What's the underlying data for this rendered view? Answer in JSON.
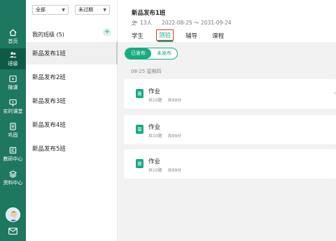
{
  "nav": {
    "items": [
      {
        "label": "首页",
        "icon": "home-icon"
      },
      {
        "label": "班级",
        "icon": "people-icon",
        "active": true
      },
      {
        "label": "微课",
        "icon": "play-icon"
      },
      {
        "label": "实时课堂",
        "icon": "live-icon"
      },
      {
        "label": "巩固",
        "icon": "document-icon"
      },
      {
        "label": "教研中心",
        "icon": "research-icon"
      },
      {
        "label": "资料中心",
        "icon": "layers-icon"
      }
    ]
  },
  "filters": {
    "grade": "全部",
    "period": "未过期"
  },
  "classes": {
    "heading": "我的班级 (5)",
    "add_label": "+",
    "items": [
      "新品发布1班",
      "新品发布2班",
      "新品发布3班",
      "新品发布4班",
      "新品发布5班"
    ]
  },
  "header": {
    "title": "新品发布1班",
    "students": "13人",
    "date_range": "2022-08-25 ～ 2031-09-24",
    "tabs": [
      "学生",
      "测验",
      "辅导",
      "课程"
    ]
  },
  "status_toggle": {
    "published": "已发布",
    "unpublished": "未发布"
  },
  "date_label": "08-25 星期四",
  "assignments": [
    {
      "title": "作业",
      "count": "共10题",
      "score": "共99分"
    },
    {
      "title": "作业",
      "count": "共10题",
      "score": "共99分"
    },
    {
      "title": "作业",
      "count": "共10题",
      "score": "共99分"
    }
  ],
  "colors": {
    "rail": "#1e7760",
    "accent": "#1aaa82",
    "highlight": "#d9372e"
  }
}
